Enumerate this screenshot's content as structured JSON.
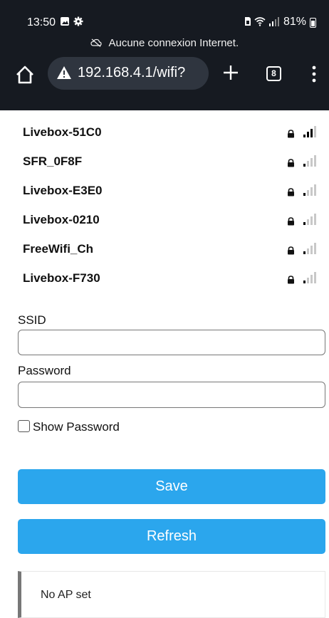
{
  "status_bar": {
    "time": "13:50",
    "battery": "81%",
    "notice": "Aucune connexion Internet."
  },
  "browser": {
    "url": "192.168.4.1/wifi?",
    "tab_count": "8"
  },
  "networks": [
    {
      "ssid": "Livebox-51C0",
      "signal_bars": 3
    },
    {
      "ssid": "SFR_0F8F",
      "signal_bars": 1
    },
    {
      "ssid": "Livebox-E3E0",
      "signal_bars": 1
    },
    {
      "ssid": "Livebox-0210",
      "signal_bars": 1
    },
    {
      "ssid": "FreeWifi_Ch",
      "signal_bars": 1
    },
    {
      "ssid": "Livebox-F730",
      "signal_bars": 1
    }
  ],
  "form": {
    "ssid_label": "SSID",
    "ssid_value": "",
    "password_label": "Password",
    "password_value": "",
    "show_password_label": "Show Password",
    "show_password_checked": false
  },
  "buttons": {
    "save": "Save",
    "refresh": "Refresh"
  },
  "message": "No AP set",
  "colors": {
    "header_bg": "#161a21",
    "url_pill_bg": "#2f353f",
    "button_bg": "#2ba6ed",
    "signal_active": "#000000",
    "signal_inactive": "#c8c8c8"
  },
  "icons": [
    "image-icon",
    "gear-icon",
    "cloud-off-icon",
    "sim-icon",
    "wifi-icon",
    "signal-icon",
    "battery-icon",
    "home-icon",
    "warning-icon",
    "plus-icon",
    "tabs-icon",
    "menu-icon",
    "lock-icon",
    "signal-bars-icon"
  ]
}
